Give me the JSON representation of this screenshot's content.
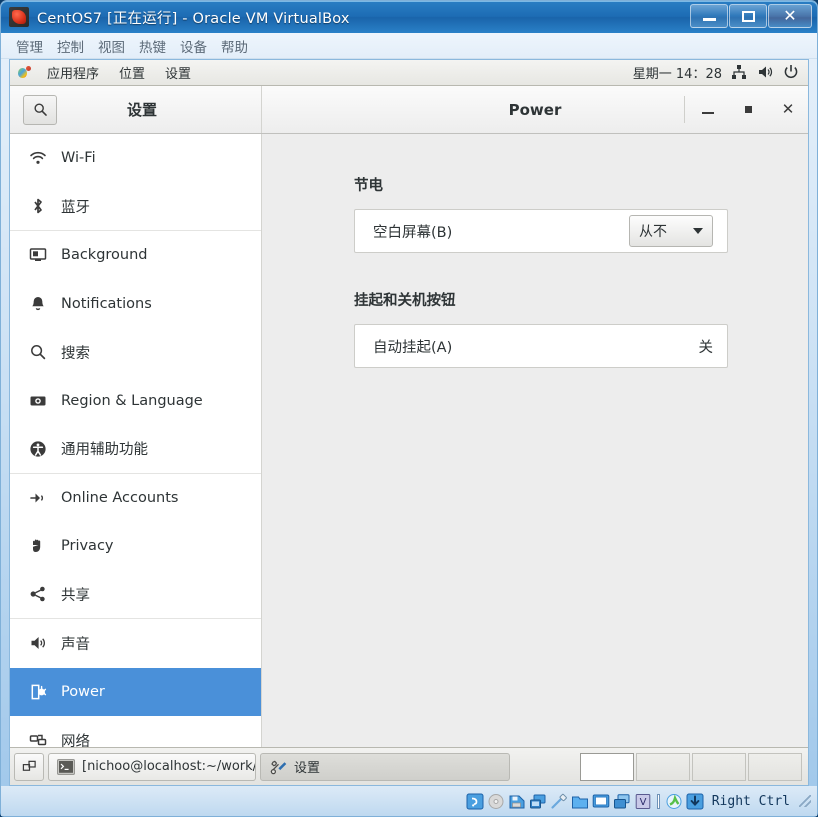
{
  "vbox": {
    "title": "CentOS7 [正在运行] - Oracle VM VirtualBox",
    "icon": "virtualbox-icon",
    "window_controls": {
      "minimize": "_",
      "maximize": "□",
      "close": "X"
    },
    "menus": [
      "管理",
      "控制",
      "视图",
      "热键",
      "设备",
      "帮助"
    ],
    "statusbar": {
      "host_key": "Right Ctrl",
      "icons": [
        "hdd-icon",
        "cd-icon",
        "floppy-icon",
        "network-icon",
        "usb-icon",
        "shared-folders-icon",
        "display-icon",
        "recording-icon",
        "vrde-icon",
        "mouse-integration-icon",
        "host-key-icon"
      ]
    }
  },
  "gnome_panel": {
    "foot_icon": "gnome-foot-icon",
    "menus": [
      "应用程序",
      "位置",
      "设置"
    ],
    "clock": "星期一 14：28",
    "tray_icons": [
      "network-icon",
      "volume-icon",
      "power-icon"
    ]
  },
  "settings": {
    "header": {
      "search_icon": "search-icon",
      "left_title": "设置",
      "right_title": "Power",
      "minimize": "minimize-icon",
      "maximize": "maximize-icon",
      "close": "close-icon"
    },
    "sidebar": [
      {
        "label": "Wi-Fi",
        "icon": "wifi-icon",
        "selected": false,
        "separator_after": false
      },
      {
        "label": "蓝牙",
        "icon": "bluetooth-icon",
        "selected": false,
        "separator_after": true
      },
      {
        "label": "Background",
        "icon": "background-icon",
        "selected": false,
        "separator_after": false
      },
      {
        "label": "Notifications",
        "icon": "bell-icon",
        "selected": false,
        "separator_after": false
      },
      {
        "label": "搜索",
        "icon": "search-icon",
        "selected": false,
        "separator_after": false
      },
      {
        "label": "Region & Language",
        "icon": "region-language-icon",
        "selected": false,
        "separator_after": false
      },
      {
        "label": "通用辅助功能",
        "icon": "accessibility-icon",
        "selected": false,
        "separator_after": true
      },
      {
        "label": "Online Accounts",
        "icon": "online-accounts-icon",
        "selected": false,
        "separator_after": false
      },
      {
        "label": "Privacy",
        "icon": "privacy-hand-icon",
        "selected": false,
        "separator_after": false
      },
      {
        "label": "共享",
        "icon": "sharing-icon",
        "selected": false,
        "separator_after": true
      },
      {
        "label": "声音",
        "icon": "sound-icon",
        "selected": false,
        "separator_after": false
      },
      {
        "label": "Power",
        "icon": "power-plug-icon",
        "selected": true,
        "separator_after": false
      },
      {
        "label": "网络",
        "icon": "network-icon",
        "selected": false,
        "separator_after": false
      }
    ],
    "content": {
      "section_power_saving": {
        "title": "节电",
        "rows": [
          {
            "label": "空白屏幕(B)",
            "control": "combo",
            "value": "从不"
          }
        ]
      },
      "section_suspend": {
        "title": "挂起和关机按钮",
        "rows": [
          {
            "label": "自动挂起(A)",
            "control": "value",
            "value": "关"
          }
        ]
      }
    }
  },
  "taskbar": {
    "show_desktop_icon": "show-desktop-icon",
    "tasks": [
      {
        "label": "[nichoo@localhost:~/work/FVCO···",
        "icon": "terminal-icon",
        "active": false
      },
      {
        "label": "设置",
        "icon": "settings-tools-icon",
        "active": true
      }
    ],
    "workspaces": [
      {
        "active": true
      },
      {
        "active": false
      },
      {
        "active": false
      },
      {
        "active": false
      }
    ]
  },
  "colors": {
    "accent_blue": "#4a90d9",
    "titlebar_blue": "#1d6cb4",
    "panel_gray": "#ededed",
    "sidebar_white": "#ffffff",
    "text": "#2e3436"
  }
}
